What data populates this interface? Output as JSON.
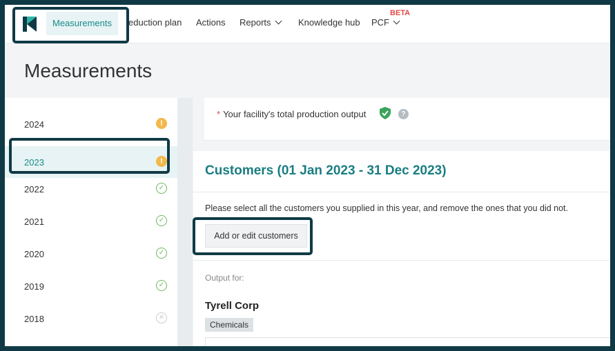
{
  "nav": {
    "active_label": "Measurements",
    "items": [
      {
        "label": "Production plan",
        "visible_text": "eduction plan"
      },
      {
        "label": "Actions"
      },
      {
        "label": "Reports"
      },
      {
        "label": "Knowledge hub"
      },
      {
        "label": "PCF",
        "badge": "BETA"
      }
    ]
  },
  "page": {
    "title": "Measurements"
  },
  "sidebar": {
    "years": [
      {
        "label": "2024",
        "status": "warning"
      },
      {
        "label": "2023",
        "status": "warning",
        "selected": true
      },
      {
        "label": "2022",
        "status": "complete"
      },
      {
        "label": "2021",
        "status": "complete"
      },
      {
        "label": "2020",
        "status": "complete"
      },
      {
        "label": "2019",
        "status": "complete"
      },
      {
        "label": "2018",
        "status": "not-applicable"
      }
    ]
  },
  "production": {
    "label": "Your facility's total production output",
    "required_mark": "*"
  },
  "customers": {
    "title": "Customers (01 Jan 2023 - 31 Dec 2023)",
    "instruction": "Please select all the customers you supplied in this year, and remove the ones that you did not.",
    "button_label": "Add or edit customers",
    "output_for_label": "Output for:",
    "customer_name": "Tyrell Corp",
    "tag": "Chemicals"
  },
  "colors": {
    "accent": "#1a8a8a",
    "highlight": "#0f3a45",
    "warning": "#f2b84b",
    "ok": "#6cba5a"
  }
}
